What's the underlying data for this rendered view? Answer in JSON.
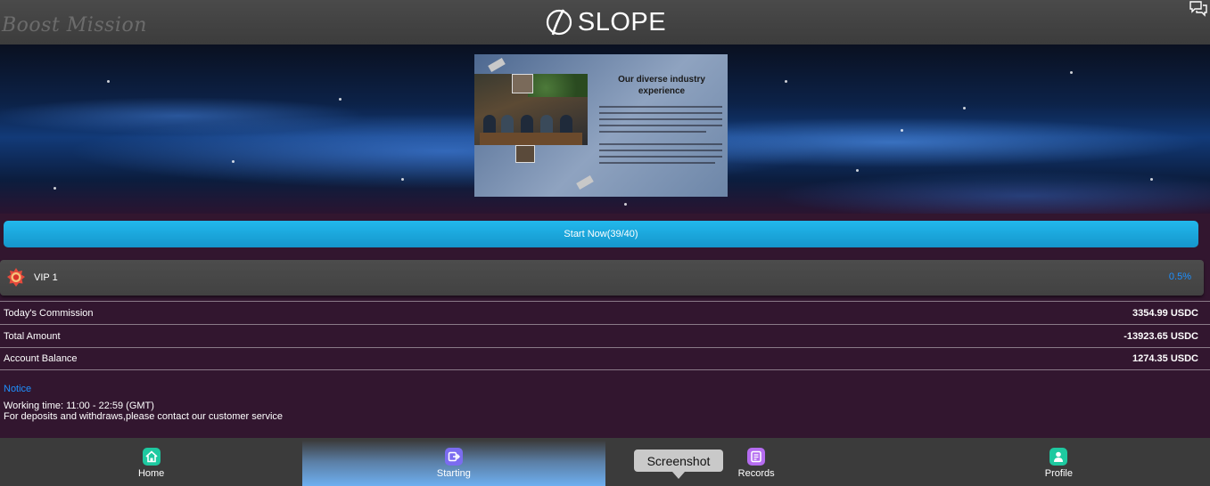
{
  "header": {
    "page_title": "Boost Mission",
    "brand": "SLOPE",
    "chat_icon": "chat-bubbles-icon"
  },
  "banner": {
    "title_line1": "Our diverse industry",
    "title_line2": "experience"
  },
  "start": {
    "label": "Start Now(39/40)"
  },
  "vip": {
    "level": "VIP 1",
    "rate": "0.5%",
    "icon": "vip-medal-icon"
  },
  "stats": [
    {
      "label": "Today's Commission",
      "value": "3354.99 USDC"
    },
    {
      "label": "Total Amount",
      "value": "-13923.65 USDC"
    },
    {
      "label": "Account Balance",
      "value": "1274.35 USDC"
    }
  ],
  "notice": {
    "title": "Notice",
    "line1": "Working time: 11:00 - 22:59 (GMT)",
    "line2": "For deposits and withdraws,please contact our customer service"
  },
  "nav": [
    {
      "label": "Home",
      "icon": "home-icon",
      "color": "#1ec9a0"
    },
    {
      "label": "Starting",
      "icon": "start-icon",
      "color": "#7b6cf0"
    },
    {
      "label": "Records",
      "icon": "records-icon",
      "color": "#b56cf0"
    },
    {
      "label": "Profile",
      "icon": "profile-icon",
      "color": "#1ec9a0"
    }
  ],
  "tooltip": "Screenshot",
  "colors": {
    "accent": "#1e90ff",
    "button": "#1ca8e0",
    "background": "#32162f"
  }
}
